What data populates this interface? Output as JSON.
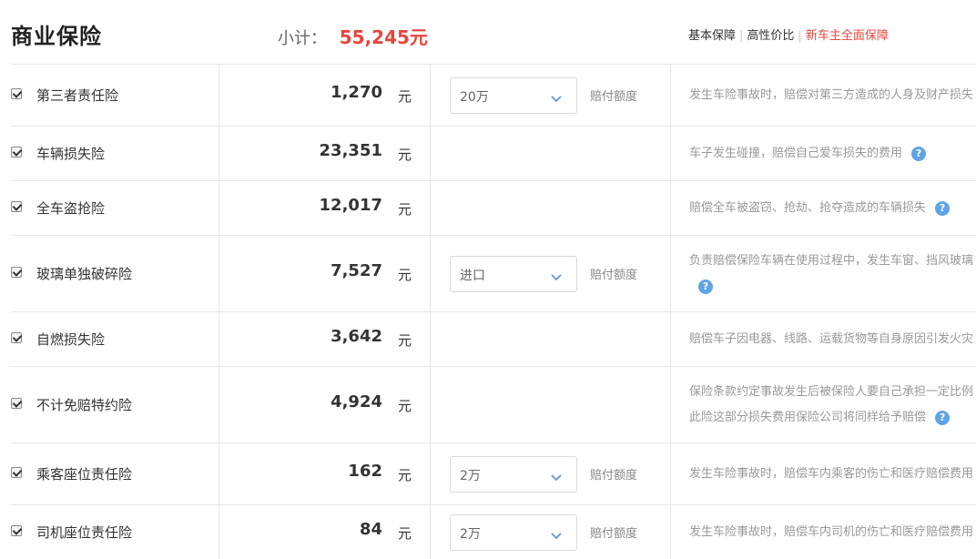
{
  "header": {
    "title": "商业保险",
    "subtotal_label": "小计：",
    "subtotal_value": "55,245元",
    "links": [
      "基本保障",
      "高性价比",
      "新车主全面保障"
    ]
  },
  "currency_unit": "元",
  "rows": [
    {
      "name": "第三者责任险",
      "price": "1,270",
      "option": "20万",
      "option_label": "赔付额度",
      "desc": [
        "发生车险事故时，赔偿对第三方造成的人身及财产损失"
      ],
      "help": false
    },
    {
      "name": "车辆损失险",
      "price": "23,351",
      "option": "",
      "option_label": "",
      "desc": [
        "车子发生碰撞，赔偿自己爱车损失的费用"
      ],
      "help": true
    },
    {
      "name": "全车盗抢险",
      "price": "12,017",
      "option": "",
      "option_label": "",
      "desc": [
        "赔偿全车被盗窃、抢劫、抢夺造成的车辆损失"
      ],
      "help": true
    },
    {
      "name": "玻璃单独破碎险",
      "price": "7,527",
      "option": "进口",
      "option_label": "赔付额度",
      "desc": [
        "负责赔偿保险车辆在使用过程中，发生车窗、挡风玻璃",
        ""
      ],
      "help": true
    },
    {
      "name": "自燃损失险",
      "price": "3,642",
      "option": "",
      "option_label": "",
      "desc": [
        "赔偿车子因电器、线路、运载货物等自身原因引发火灾"
      ],
      "help": false
    },
    {
      "name": "不计免赔特约险",
      "price": "4,924",
      "option": "",
      "option_label": "",
      "desc": [
        "保险条款约定事故发生后被保险人要自己承担一定比例",
        "此险这部分损失费用保险公司将同样给予赔偿"
      ],
      "help": true
    },
    {
      "name": "乘客座位责任险",
      "price": "162",
      "option": "2万",
      "option_label": "赔付额度",
      "desc": [
        "发生车险事故时，赔偿车内乘客的伤亡和医疗赔偿费用"
      ],
      "help": false
    },
    {
      "name": "司机座位责任险",
      "price": "84",
      "option": "2万",
      "option_label": "赔付额度",
      "desc": [
        "发生车险事故时，赔偿车内司机的伤亡和医疗赔偿费用"
      ],
      "help": false
    }
  ],
  "icons": {
    "checkbox": "checked-checkbox-icon",
    "dropdown": "chevron-down-icon",
    "help": "question-mark-icon"
  },
  "colors": {
    "accent": "#e8453c",
    "help": "#5fa4e6",
    "border": "#e6e6e6"
  }
}
